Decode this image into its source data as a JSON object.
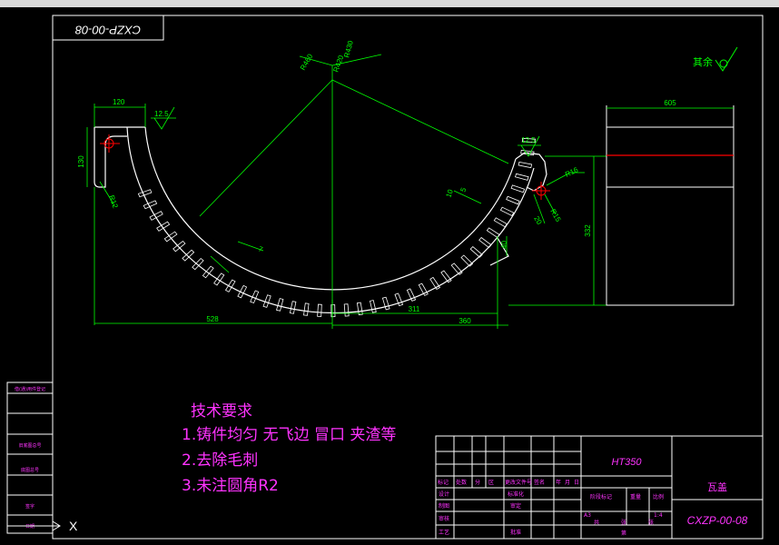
{
  "colors": {
    "background": "#000000",
    "frame": "#ffffff",
    "dimension": "#00ff00",
    "text_magenta": "#ff33ff",
    "centerline_red": "#ff0000",
    "title_text": "#ffffff"
  },
  "drawing": {
    "code_upside_down": "CXZP-00-08",
    "roughness_note": "其余",
    "material": "HT350",
    "part_name": "瓦盖",
    "part_code": "CXZP-00-08",
    "scale": "1:4",
    "sheet_size": "A3"
  },
  "dimensions": {
    "r460": "R460",
    "r420": "R420",
    "r430": "R430",
    "w120": "120",
    "h130": "130",
    "r12": "R12",
    "rough_left": "12.5",
    "rough_right": "12.5",
    "r16": "R16",
    "r15": "R15",
    "d5": "5",
    "d20": "20",
    "h40": "40",
    "d7": "7",
    "d10": "10",
    "w528": "528",
    "w311": "311",
    "w360": "360",
    "w605": "605",
    "h332": "332"
  },
  "tech_requirements": {
    "title": "技术要求",
    "items": [
      "1.铸件均匀 无飞边 冒口 夹渣等",
      "2.去除毛刺",
      "3.未注圆角R2"
    ]
  },
  "title_block": {
    "header_row": [
      "标记",
      "处数",
      "分",
      "区",
      "更改文件号",
      "签名",
      "年",
      "月",
      "日"
    ],
    "row_design": "设计",
    "row_standard": "标准化",
    "row_drawn": "制图",
    "row_check": "审核",
    "row_review": "审定",
    "row_process": "工艺",
    "row_approve": "批准",
    "stage_mark": "阶段标记",
    "weight": "重量",
    "ratio": "比例",
    "total": "共",
    "sheet": "张",
    "page": "第",
    "page2": "张"
  },
  "side_table": [
    "借(通)用件登记",
    "旧底图总号",
    "底图总号",
    "签字",
    "日期"
  ],
  "ucs_x": "X"
}
